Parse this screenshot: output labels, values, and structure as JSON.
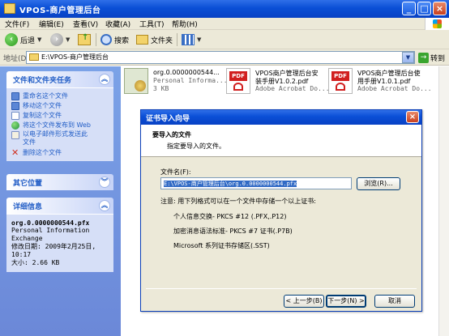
{
  "window": {
    "title": "VPOS-商户管理后台",
    "controls": {
      "minimize": "_",
      "maximize": "□",
      "close": "×"
    }
  },
  "menu": [
    {
      "label": "文件(F)"
    },
    {
      "label": "编辑(E)"
    },
    {
      "label": "查看(V)"
    },
    {
      "label": "收藏(A)"
    },
    {
      "label": "工具(T)"
    },
    {
      "label": "帮助(H)"
    }
  ],
  "toolbar": {
    "back_label": "后退",
    "search_label": "搜索",
    "folders_label": "文件夹"
  },
  "address": {
    "label": "地址(D)",
    "value": "E:\\VPOS-商户管理后台",
    "go_label": "转到"
  },
  "left_pane": {
    "tasks_panel": {
      "title": "文件和文件夹任务",
      "items": [
        {
          "label": "重命名这个文件",
          "icon": "rename-icon"
        },
        {
          "label": "移动这个文件",
          "icon": "move-icon"
        },
        {
          "label": "复制这个文件",
          "icon": "copy-icon"
        },
        {
          "label": "将这个文件发布到 Web",
          "icon": "publish-web-icon"
        },
        {
          "label": "以电子邮件形式发送此",
          "label2": "文件",
          "icon": "email-icon"
        },
        {
          "label": "删除这个文件",
          "icon": "delete-icon"
        }
      ]
    },
    "other_places": {
      "title": "其它位置"
    },
    "details": {
      "title": "详细信息",
      "name": "org.0.0000000544.pfx",
      "type_line1": "Personal Information",
      "type_line2": "Exchange",
      "modified_line1": "修改日期: 2009年2月25日,",
      "modified_line2": "10:17",
      "size": "大小: 2.66 KB"
    }
  },
  "files": [
    {
      "name": "org.0.0000000544...",
      "line2": "Personal Informa...",
      "line3": "3 KB",
      "icon": "certificate-icon"
    },
    {
      "name": "VPOS商户管理后台安",
      "line2": "装手册V1.0.2.pdf",
      "line3": "Adobe Acrobat Do...",
      "icon": "pdf-icon"
    },
    {
      "name": "VPOS商户管理后台使",
      "line2": "用手册V1.0.1.pdf",
      "line3": "Adobe Acrobat Do...",
      "icon": "pdf-icon"
    }
  ],
  "dialog": {
    "title": "证书导入向导",
    "heading": "要导入的文件",
    "subheading": "指定要导入的文件。",
    "file_label": "文件名(F):",
    "file_value": "E:\\VPOS-商户管理后台\\org.0.0000000544.pfx",
    "browse_label": "浏览(R)...",
    "note": "注意:  用下列格式可以在一个文件中存储一个以上证书:",
    "formats": [
      "个人信息交换- PKCS #12 (.PFX,.P12)",
      "加密消息语法标准- PKCS #7 证书(.P7B)",
      "Microsoft 系列证书存储区(.SST)"
    ],
    "buttons": {
      "back": "< 上一步(B)",
      "next": "下一步(N) >",
      "cancel": "取消"
    }
  }
}
